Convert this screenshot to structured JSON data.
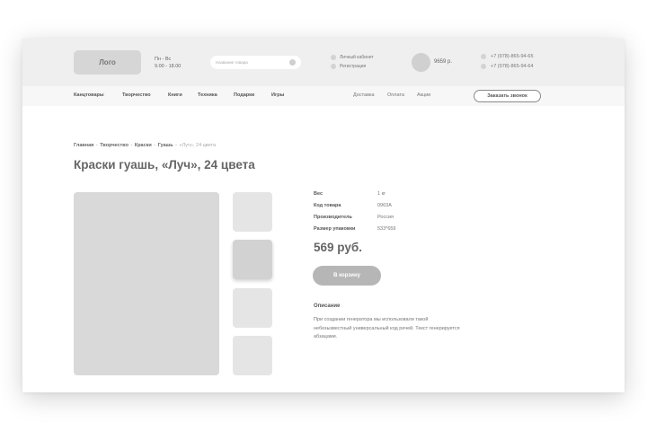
{
  "header": {
    "logo": "Лого",
    "hours": {
      "days": "Пн - Вс",
      "time": "9.00 - 18.00"
    },
    "search": {
      "placeholder": "Название товара",
      "value": ""
    },
    "account": {
      "cabinet": "Личный кабинет",
      "register": "Регистрация"
    },
    "cart": {
      "sum": "9659 р."
    },
    "phones": [
      "+7 (978)-865-94-65",
      "+7 (978)-865-94-64"
    ]
  },
  "nav": {
    "categories": [
      "Канцтовары",
      "Творчество",
      "Книги",
      "Техника",
      "Подарки",
      "Игры"
    ],
    "links": [
      "Доставка",
      "Оплата",
      "Акции"
    ],
    "callback": "Заказать звонок"
  },
  "breadcrumb": {
    "items": [
      "Главная",
      "Творчество",
      "Краски",
      "Гуашь"
    ],
    "separator": "-",
    "current": "«Луч», 24 цвета"
  },
  "product": {
    "title": "Краски гуашь, «Луч», 24 цвета",
    "specs": [
      {
        "label": "Вес",
        "value": "1 кг"
      },
      {
        "label": "Код товара",
        "value": "0963А"
      },
      {
        "label": "Производитель",
        "value": "Россия"
      },
      {
        "label": "Размер упаковки",
        "value": "533*659"
      }
    ],
    "price": "569 руб.",
    "buy_label": "В корзину",
    "description_heading": "Описание",
    "description": "При создании генератора мы использовали такой небезызвестный универсальный код речей. Текст генерируется абзацами."
  }
}
